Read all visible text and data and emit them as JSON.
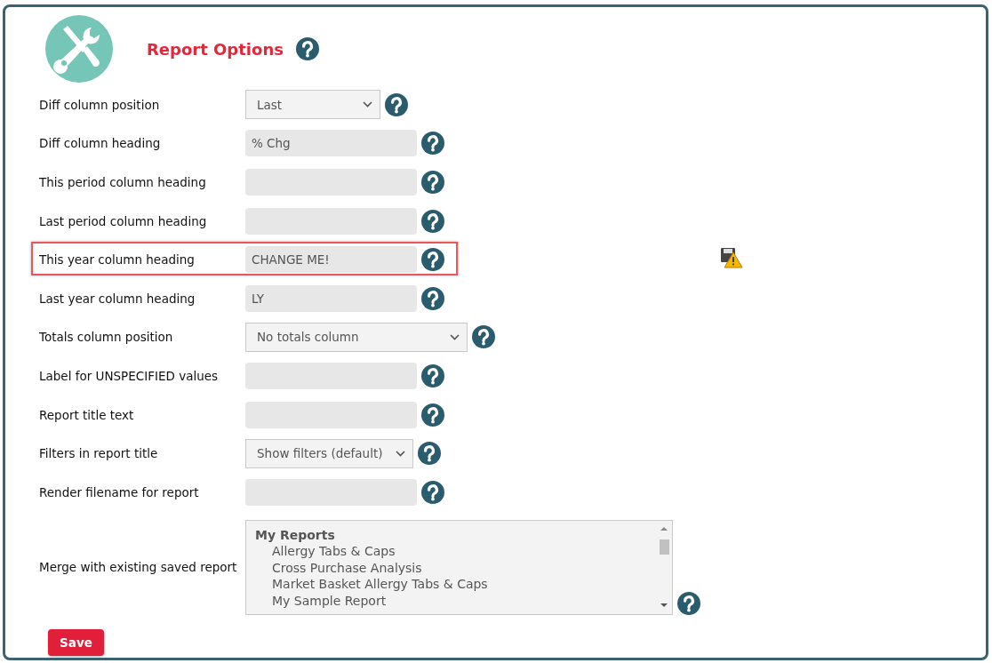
{
  "header": {
    "title": "Report Options"
  },
  "rows": [
    {
      "kind": "select",
      "label": "Diff column position",
      "value": "Last",
      "highlighted": false,
      "warning": false
    },
    {
      "kind": "text",
      "label": "Diff column heading",
      "value": "% Chg",
      "highlighted": false,
      "warning": false
    },
    {
      "kind": "text",
      "label": "This period column heading",
      "value": "",
      "highlighted": false,
      "warning": false
    },
    {
      "kind": "text",
      "label": "Last period column heading",
      "value": "",
      "highlighted": false,
      "warning": false
    },
    {
      "kind": "text",
      "label": "This year column heading",
      "value": "CHANGE ME!",
      "highlighted": true,
      "warning": true
    },
    {
      "kind": "text",
      "label": "Last year column heading",
      "value": "LY",
      "highlighted": false,
      "warning": false
    },
    {
      "kind": "select",
      "label": "Totals column position",
      "value": "No totals column",
      "highlighted": false,
      "warning": false
    },
    {
      "kind": "text",
      "label": "Label for UNSPECIFIED values",
      "value": "",
      "highlighted": false,
      "warning": false
    },
    {
      "kind": "text",
      "label": "Report title text",
      "value": "",
      "highlighted": false,
      "warning": false
    },
    {
      "kind": "select",
      "label": "Filters in report title",
      "value": "Show filters (default)",
      "highlighted": false,
      "warning": false
    },
    {
      "kind": "text",
      "label": "Render filename for report",
      "value": "",
      "highlighted": false,
      "warning": false
    }
  ],
  "merge": {
    "label": "Merge with existing saved report",
    "groups": [
      {
        "label": "My Reports",
        "items": [
          "Allergy Tabs & Caps",
          "Cross Purchase Analysis",
          "Market Basket Allergy Tabs & Caps",
          "My Sample Report"
        ]
      }
    ]
  },
  "save_button": "Save"
}
